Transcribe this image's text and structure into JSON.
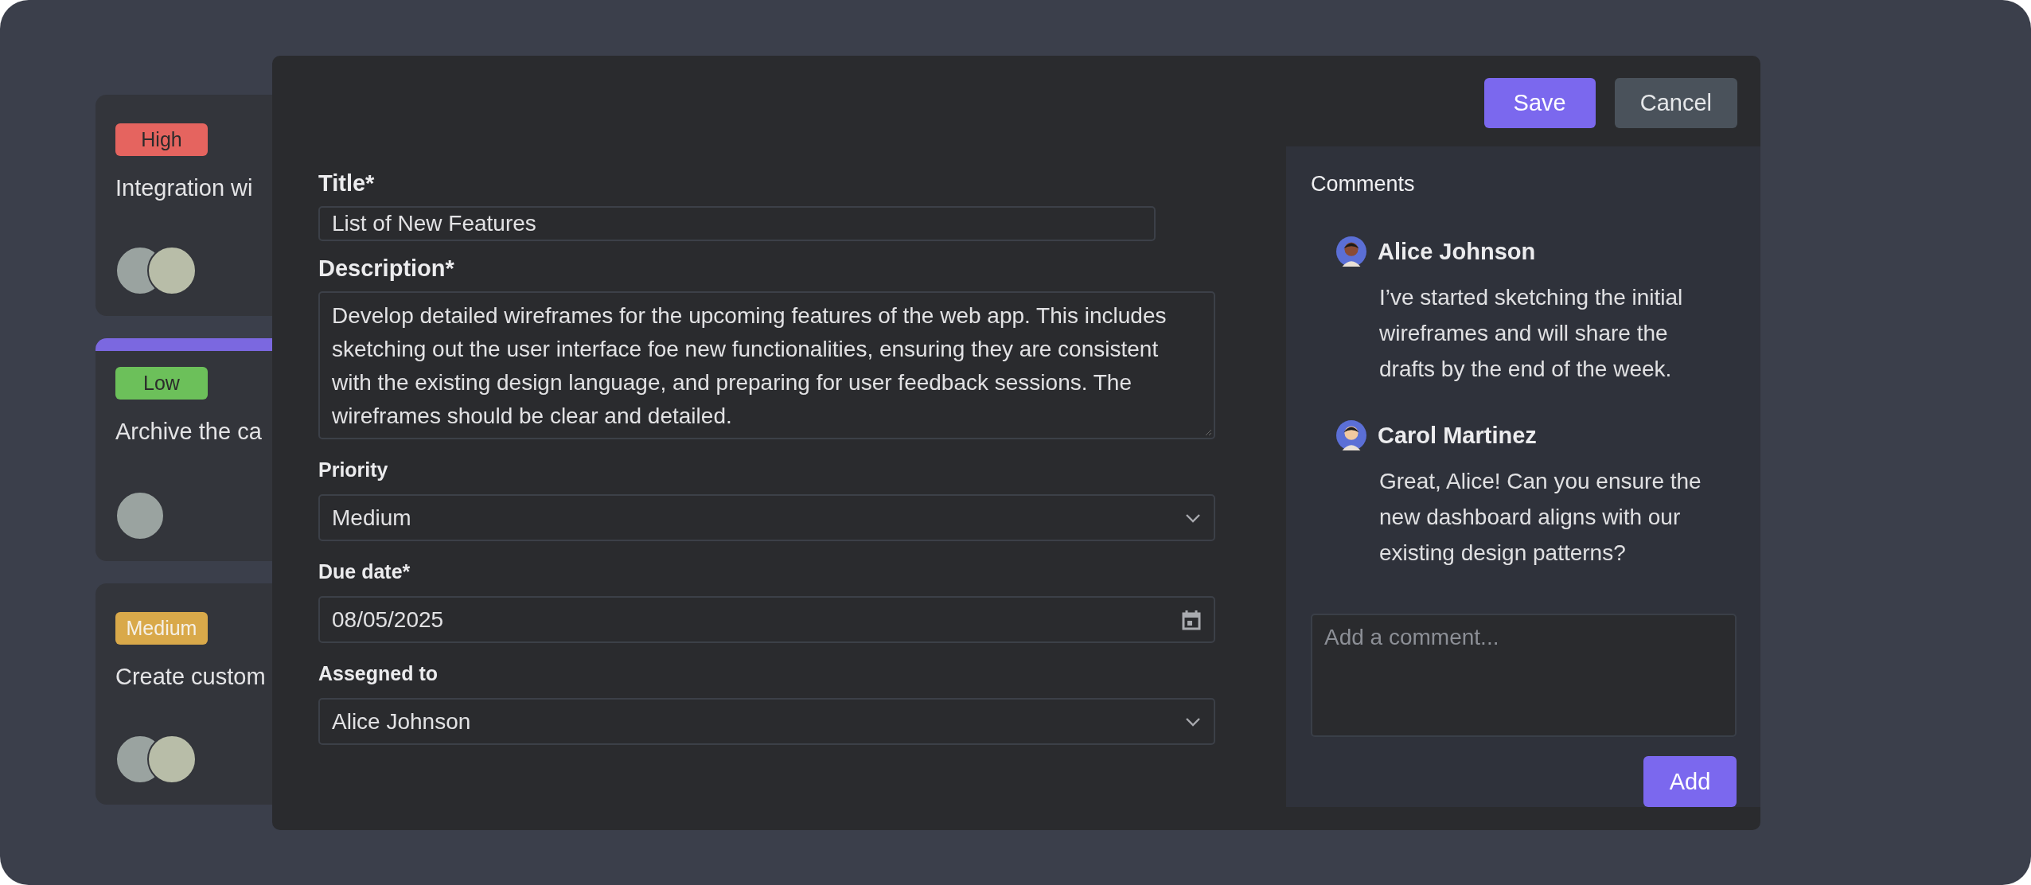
{
  "cards": [
    {
      "priority": {
        "label": "High",
        "color": "#e5645f"
      },
      "title": "Integration wi",
      "selected": false,
      "avatars": [
        {
          "kind": "photo"
        },
        {
          "kind": "photo"
        }
      ]
    },
    {
      "priority": {
        "label": "Low",
        "color": "#6cc05a"
      },
      "title": "Archive the ca",
      "selected": true,
      "avatars": [
        {
          "kind": "photo"
        }
      ]
    },
    {
      "priority": {
        "label": "Medium",
        "color": "#d9a94a"
      },
      "title": "Create custom",
      "selected": false,
      "avatars": [
        {
          "kind": "photo"
        },
        {
          "kind": "photo"
        }
      ]
    }
  ],
  "modal": {
    "buttons": [
      {
        "label": "Save",
        "kind": "primary"
      },
      {
        "label": "Cancel",
        "kind": "secondary"
      }
    ],
    "fields": [
      {
        "kind": "text",
        "label": "Title*",
        "value": "List of New Features"
      },
      {
        "kind": "textarea",
        "label": "Description*",
        "value": "Develop detailed wireframes for the upcoming features of the web app. This includes sketching out the user interface foe new functionalities, ensuring they are consistent with the existing design language, and preparing for user feedback sessions. The wireframes should be clear and detailed."
      },
      {
        "kind": "select",
        "label": "Priority",
        "value": "Medium"
      },
      {
        "kind": "date",
        "label": "Due date*",
        "value": "08/05/2025"
      },
      {
        "kind": "select",
        "label": "Assegned to",
        "value": "Alice Johnson"
      }
    ],
    "comments": {
      "title": "Comments",
      "items": [
        {
          "author": "Alice Johnson",
          "text": "I’ve started sketching the initial wireframes and will share the drafts by the end of the week."
        },
        {
          "author": "Carol Martinez",
          "text": "Great, Alice! Can you ensure the new dashboard aligns with our existing design patterns?"
        }
      ],
      "input": {
        "placeholder": "Add a comment..."
      },
      "button": "Add"
    }
  }
}
